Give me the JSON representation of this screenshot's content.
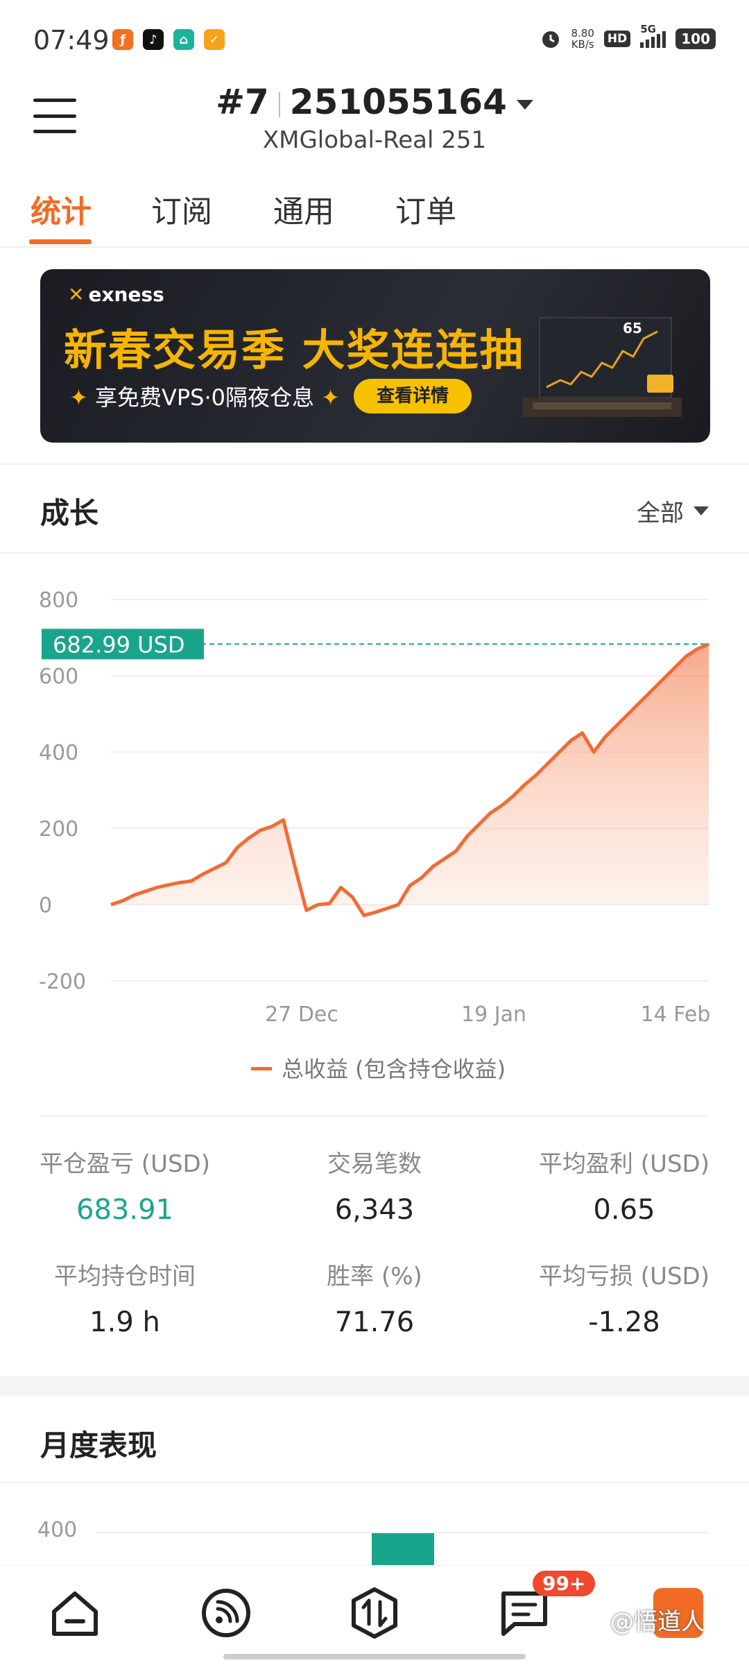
{
  "status_bar": {
    "time": "07:49",
    "network_speed_value": "8.80",
    "network_speed_unit": "KB/s",
    "hd_label": "HD",
    "signal_label": "5G",
    "battery": "100"
  },
  "header": {
    "account_index": "#7",
    "account_number": "251055164",
    "server": "XMGlobal-Real 251"
  },
  "tabs": [
    {
      "label": "统计",
      "active": true
    },
    {
      "label": "订阅",
      "active": false
    },
    {
      "label": "通用",
      "active": false
    },
    {
      "label": "订单",
      "active": false
    }
  ],
  "banner": {
    "brand": "exness",
    "headline": "新春交易季 大奖连连抽",
    "subtitle": "享免费VPS·0隔夜仓息",
    "cta": "查看详情",
    "art_label": "65"
  },
  "growth": {
    "title": "成长",
    "range_label": "全部",
    "current_value_label": "682.99 USD",
    "legend": "总收益 (包含持仓收益)"
  },
  "chart_data": {
    "type": "area",
    "title": "",
    "xlabel": "",
    "ylabel": "",
    "ylim": [
      -200,
      800
    ],
    "yticks": [
      800,
      600,
      400,
      200,
      0,
      -200
    ],
    "xticks": [
      "27 Dec",
      "19 Jan",
      "14 Feb"
    ],
    "legend_position": "bottom",
    "grid": true,
    "current_value": 682.99,
    "series": [
      {
        "name": "总收益 (包含持仓收益)",
        "color": "#f26b35",
        "points": [
          0,
          10,
          25,
          35,
          45,
          52,
          58,
          62,
          80,
          95,
          110,
          150,
          175,
          195,
          205,
          222,
          100,
          -15,
          0,
          3,
          45,
          20,
          -28,
          -20,
          -10,
          0,
          50,
          70,
          100,
          120,
          140,
          180,
          210,
          240,
          260,
          285,
          315,
          340,
          370,
          400,
          430,
          450,
          400,
          440,
          470,
          500,
          530,
          560,
          590,
          620,
          650,
          670,
          683
        ]
      }
    ]
  },
  "stats": [
    {
      "label": "平仓盈亏 (USD)",
      "value": "683.91",
      "positive": true
    },
    {
      "label": "交易笔数",
      "value": "6,343",
      "positive": false
    },
    {
      "label": "平均盈利 (USD)",
      "value": "0.65",
      "positive": false
    },
    {
      "label": "平均持仓时间",
      "value": "1.9 h",
      "positive": false
    },
    {
      "label": "胜率 (%)",
      "value": "71.76",
      "positive": false
    },
    {
      "label": "平均亏损 (USD)",
      "value": "-1.28",
      "positive": false
    }
  ],
  "monthly": {
    "title": "月度表现",
    "y_tick": "400"
  },
  "bottom_nav": {
    "badge": "99+",
    "watermark": "@悟道人"
  },
  "colors": {
    "accent": "#f26b25",
    "positive": "#19a58c",
    "line": "#f26b35"
  }
}
